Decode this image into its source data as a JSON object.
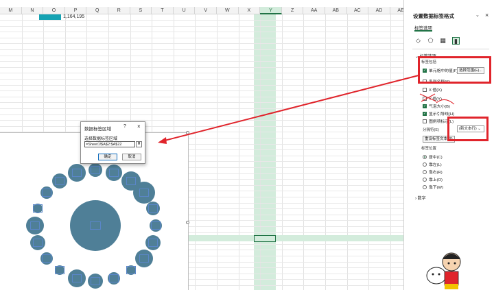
{
  "sheet": {
    "columns": [
      "M",
      "N",
      "O",
      "P",
      "Q",
      "R",
      "S",
      "T",
      "U",
      "V",
      "W",
      "X",
      "Y",
      "Z",
      "AA",
      "AB",
      "AC",
      "AD",
      "AE"
    ],
    "selected_column": "Y",
    "bar_value": "1,164,195"
  },
  "dialog": {
    "title": "数据标签区域",
    "help": "?",
    "close": "×",
    "prompt": "选择数据标签区域",
    "range_value": "=Sheet1!$A$2:$A$22",
    "ok": "确定",
    "cancel": "取消"
  },
  "pane": {
    "title": "设置数据标签格式",
    "tab": "标签选项",
    "section_label_options": "标签选项",
    "label_contains": "标签包括",
    "options": [
      {
        "label": "单元格中的值(F)",
        "checked": true
      },
      {
        "label": "系列名称(S)",
        "checked": false
      },
      {
        "label": "X 值(X)",
        "checked": false
      },
      {
        "label": "Y 值(Y)",
        "checked": false
      },
      {
        "label": "气泡大小(B)",
        "checked": true
      },
      {
        "label": "显示引导线(H)",
        "checked": true
      },
      {
        "label": "图例项标示(L)",
        "checked": false
      }
    ],
    "select_range_button": "选择范围(E)...",
    "separator_label": "分隔符(E)",
    "separator_value": "(新文本行)",
    "reset_button": "重设标签文本(R)",
    "position_label": "标签位置",
    "positions": [
      {
        "label": "居中(C)",
        "selected": true
      },
      {
        "label": "靠左(L)",
        "selected": false
      },
      {
        "label": "靠右(R)",
        "selected": false
      },
      {
        "label": "靠上(O)",
        "selected": false
      },
      {
        "label": "靠下(W)",
        "selected": false
      }
    ],
    "section_number": "数字"
  },
  "colors": {
    "accent": "#217346",
    "bubble": "#4f7f97",
    "annotation": "#e0242b",
    "bar": "#15a3b3"
  }
}
